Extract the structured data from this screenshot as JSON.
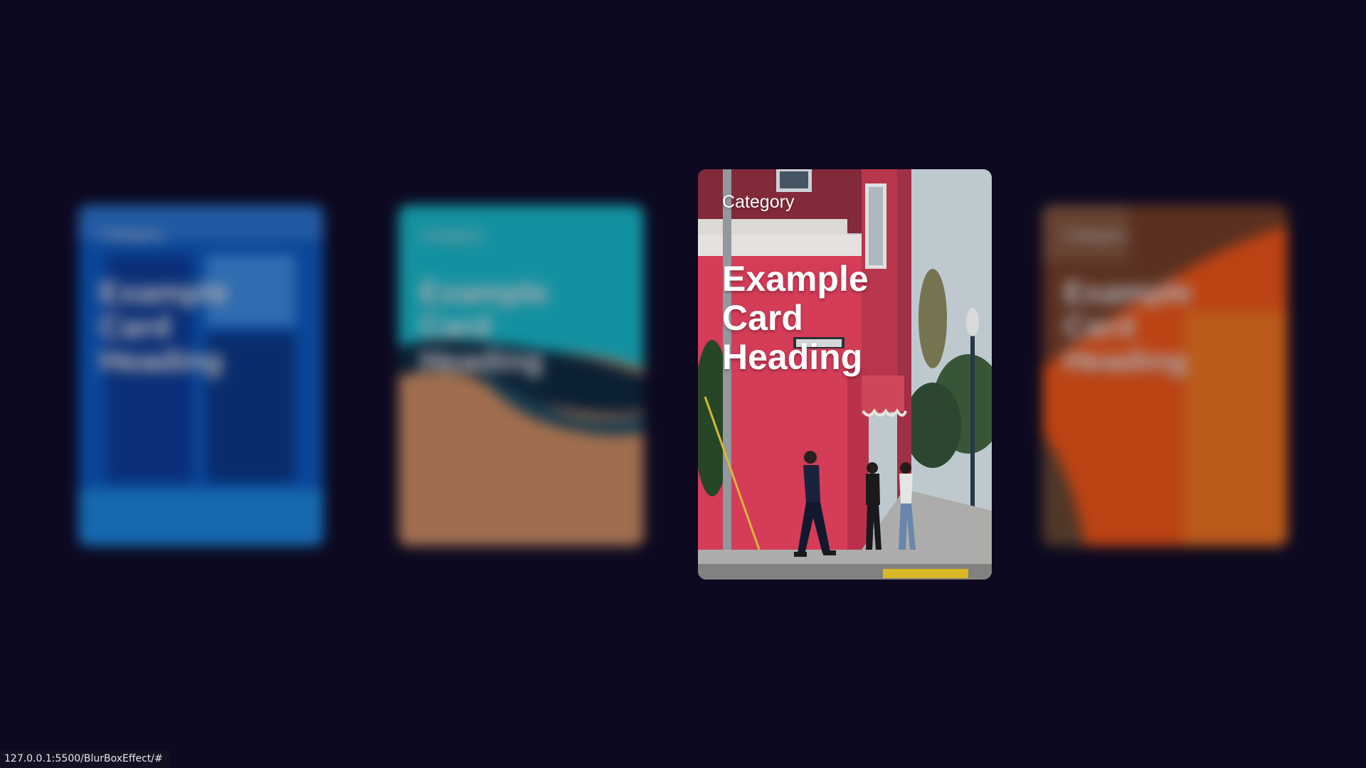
{
  "cards": [
    {
      "category": "Category",
      "heading": "Example Card Heading",
      "theme_colors": [
        "#0a5ec7",
        "#1b8ee6",
        "#06337a"
      ],
      "state": "blurred"
    },
    {
      "category": "Category",
      "heading": "Example Card Heading",
      "theme_colors": [
        "#17c6d2",
        "#0c2a3c",
        "#d99560"
      ],
      "state": "blurred"
    },
    {
      "category": "Category",
      "heading": "Example Card Heading",
      "theme_colors": [
        "#e0405d",
        "#8a2c3e",
        "#c8d4db"
      ],
      "state": "focused"
    },
    {
      "category": "Category",
      "heading": "Example Card Heading",
      "theme_colors": [
        "#ff5a10",
        "#7a4020",
        "#ff7a1a"
      ],
      "state": "blurred"
    }
  ],
  "status_bar": {
    "url": "127.0.0.1:5500/BlurBoxEffect/#"
  },
  "colors": {
    "page_background": "#0c0920",
    "text": "#ffffff"
  }
}
